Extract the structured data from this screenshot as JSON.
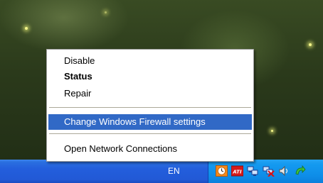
{
  "context_menu": {
    "items": [
      {
        "label": "Disable"
      },
      {
        "label": "Status"
      },
      {
        "label": "Repair"
      },
      {
        "label": "Change Windows Firewall settings"
      },
      {
        "label": "Open Network Connections"
      }
    ]
  },
  "taskbar": {
    "language": "EN",
    "tray_icons": [
      {
        "icon": "clock-icon"
      },
      {
        "icon": "ati-icon",
        "label": "ATI"
      },
      {
        "icon": "network-connection-icon"
      },
      {
        "icon": "network-disconnected-icon"
      },
      {
        "icon": "volume-icon"
      },
      {
        "icon": "green-arrow-icon"
      }
    ]
  },
  "colors": {
    "highlight": "#3169c6",
    "taskbar": "#235edc",
    "tray": "#0e8de8"
  }
}
